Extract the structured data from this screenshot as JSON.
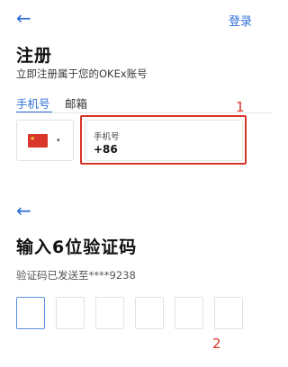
{
  "header": {
    "back_icon": "arrow-left-icon",
    "back_glyph": "←",
    "login_label": "登录"
  },
  "register": {
    "title": "注册",
    "subtitle": "立即注册属于您的OKEx账号",
    "tabs": [
      {
        "label": "手机号",
        "active": true
      },
      {
        "label": "邮箱",
        "active": false
      }
    ],
    "country": {
      "flag": "china-flag-icon",
      "caret": "▾"
    },
    "phone": {
      "label": "手机号",
      "value": "+86"
    }
  },
  "verify": {
    "back_glyph": "←",
    "title": "输入6位验证码",
    "sent_text": "验证码已发送至****9238",
    "code_box_count": 6
  },
  "annotations": {
    "first": "1",
    "second": "2"
  },
  "colors": {
    "accent": "#2f6fd6",
    "annotation": "#d8352a"
  }
}
